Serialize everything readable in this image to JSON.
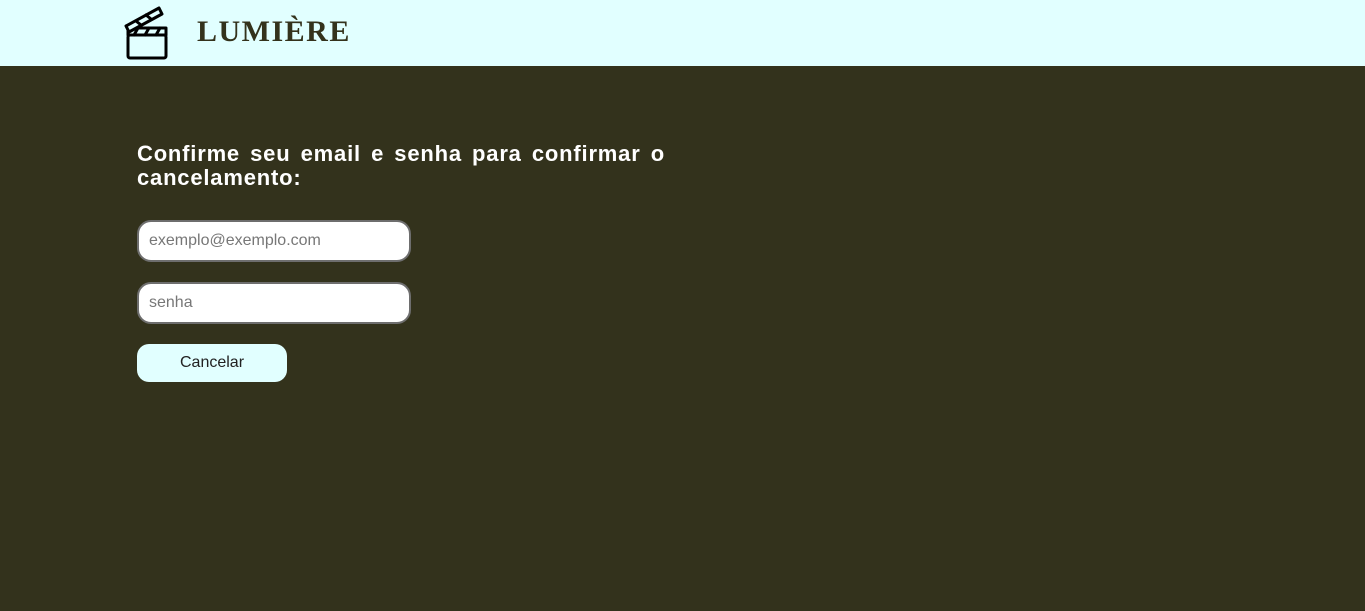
{
  "header": {
    "brand": "LUMIÈRE",
    "logo_icon": "clapperboard-icon",
    "background": "#e1ffff"
  },
  "page": {
    "background": "#33321c"
  },
  "form": {
    "heading": "Confirme seu email e senha para confirmar o cancelamento:",
    "email_placeholder": "exemplo@exemplo.com",
    "email_value": "",
    "password_placeholder": "senha",
    "password_value": "",
    "cancel_label": "Cancelar"
  }
}
